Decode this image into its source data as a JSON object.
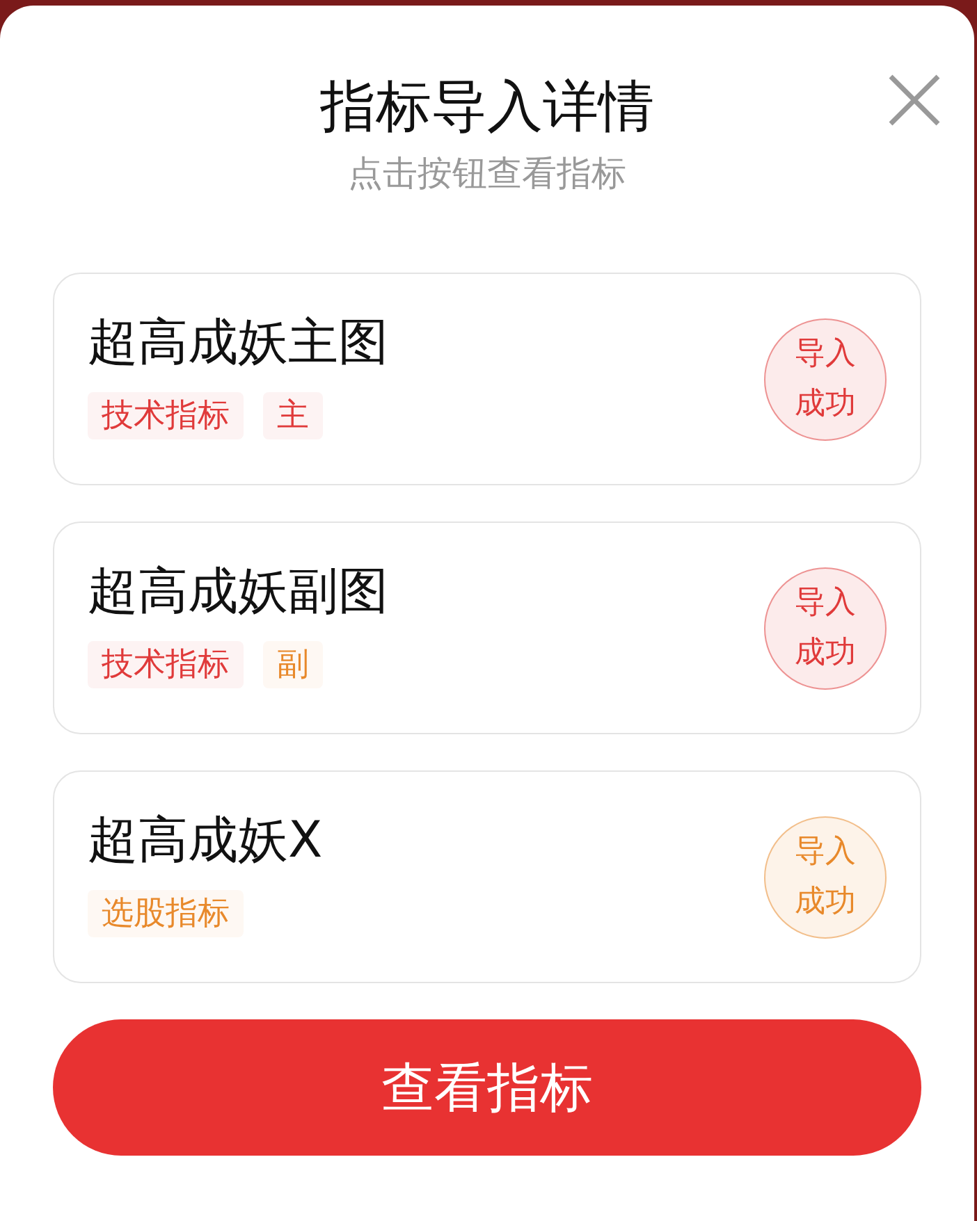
{
  "dialog": {
    "title": "指标导入详情",
    "subtitle": "点击按钮查看指标",
    "closable": true
  },
  "items": [
    {
      "name": "超高成妖主图",
      "tags": [
        {
          "label": "技术指标",
          "color": "#e03a3a"
        },
        {
          "label": "主",
          "color": "#e03a3a"
        }
      ],
      "status": {
        "label": "导入成功",
        "color": "#e03a3a"
      }
    },
    {
      "name": "超高成妖副图",
      "tags": [
        {
          "label": "技术指标",
          "color": "#e03a3a"
        },
        {
          "label": "副",
          "color": "#e8892b"
        }
      ],
      "status": {
        "label": "导入成功",
        "color": "#e03a3a"
      }
    },
    {
      "name": "超高成妖X",
      "tags": [
        {
          "label": "选股指标",
          "color": "#e8892b"
        }
      ],
      "status": {
        "label": "导入成功",
        "color": "#e8892b"
      }
    }
  ],
  "button": {
    "label": "查看指标"
  }
}
